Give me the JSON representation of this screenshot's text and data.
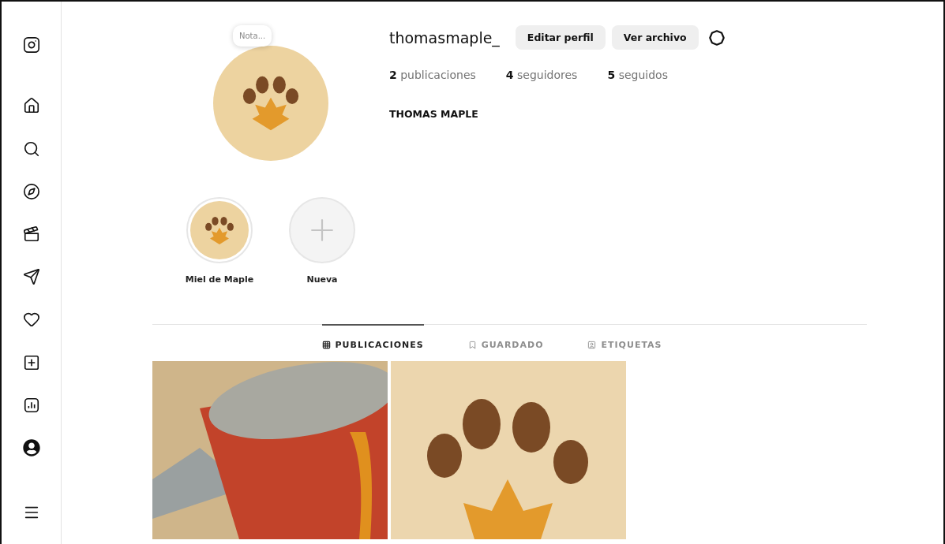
{
  "sidebar": {
    "items": [
      {
        "kind": "logo"
      },
      {
        "kind": "home"
      },
      {
        "kind": "search"
      },
      {
        "kind": "explore"
      },
      {
        "kind": "reels"
      },
      {
        "kind": "messages"
      },
      {
        "kind": "notifications"
      },
      {
        "kind": "create"
      },
      {
        "kind": "dashboard"
      },
      {
        "kind": "profile"
      },
      {
        "kind": "menu"
      }
    ]
  },
  "profile": {
    "note": "Nota...",
    "username": "thomasmaple_",
    "buttons": [
      "Editar perfil",
      "Ver archivo"
    ],
    "stats": [
      {
        "count": "2",
        "label": "publicaciones"
      },
      {
        "count": "4",
        "label": "seguidores"
      },
      {
        "count": "5",
        "label": "seguidos"
      }
    ],
    "name": "THOMAS MAPLE"
  },
  "highlights": [
    {
      "kind": "story",
      "label": "Miel de Maple"
    },
    {
      "kind": "new",
      "label": "Nueva"
    }
  ],
  "tabs": [
    {
      "kind": "grid",
      "label": "PUBLICACIONES",
      "selected": true
    },
    {
      "kind": "saved",
      "label": "GUARDADO",
      "selected": false
    },
    {
      "kind": "tagged",
      "label": "ETIQUETAS",
      "selected": false
    }
  ],
  "posts": [
    {
      "kind": "can"
    },
    {
      "kind": "paw"
    }
  ]
}
